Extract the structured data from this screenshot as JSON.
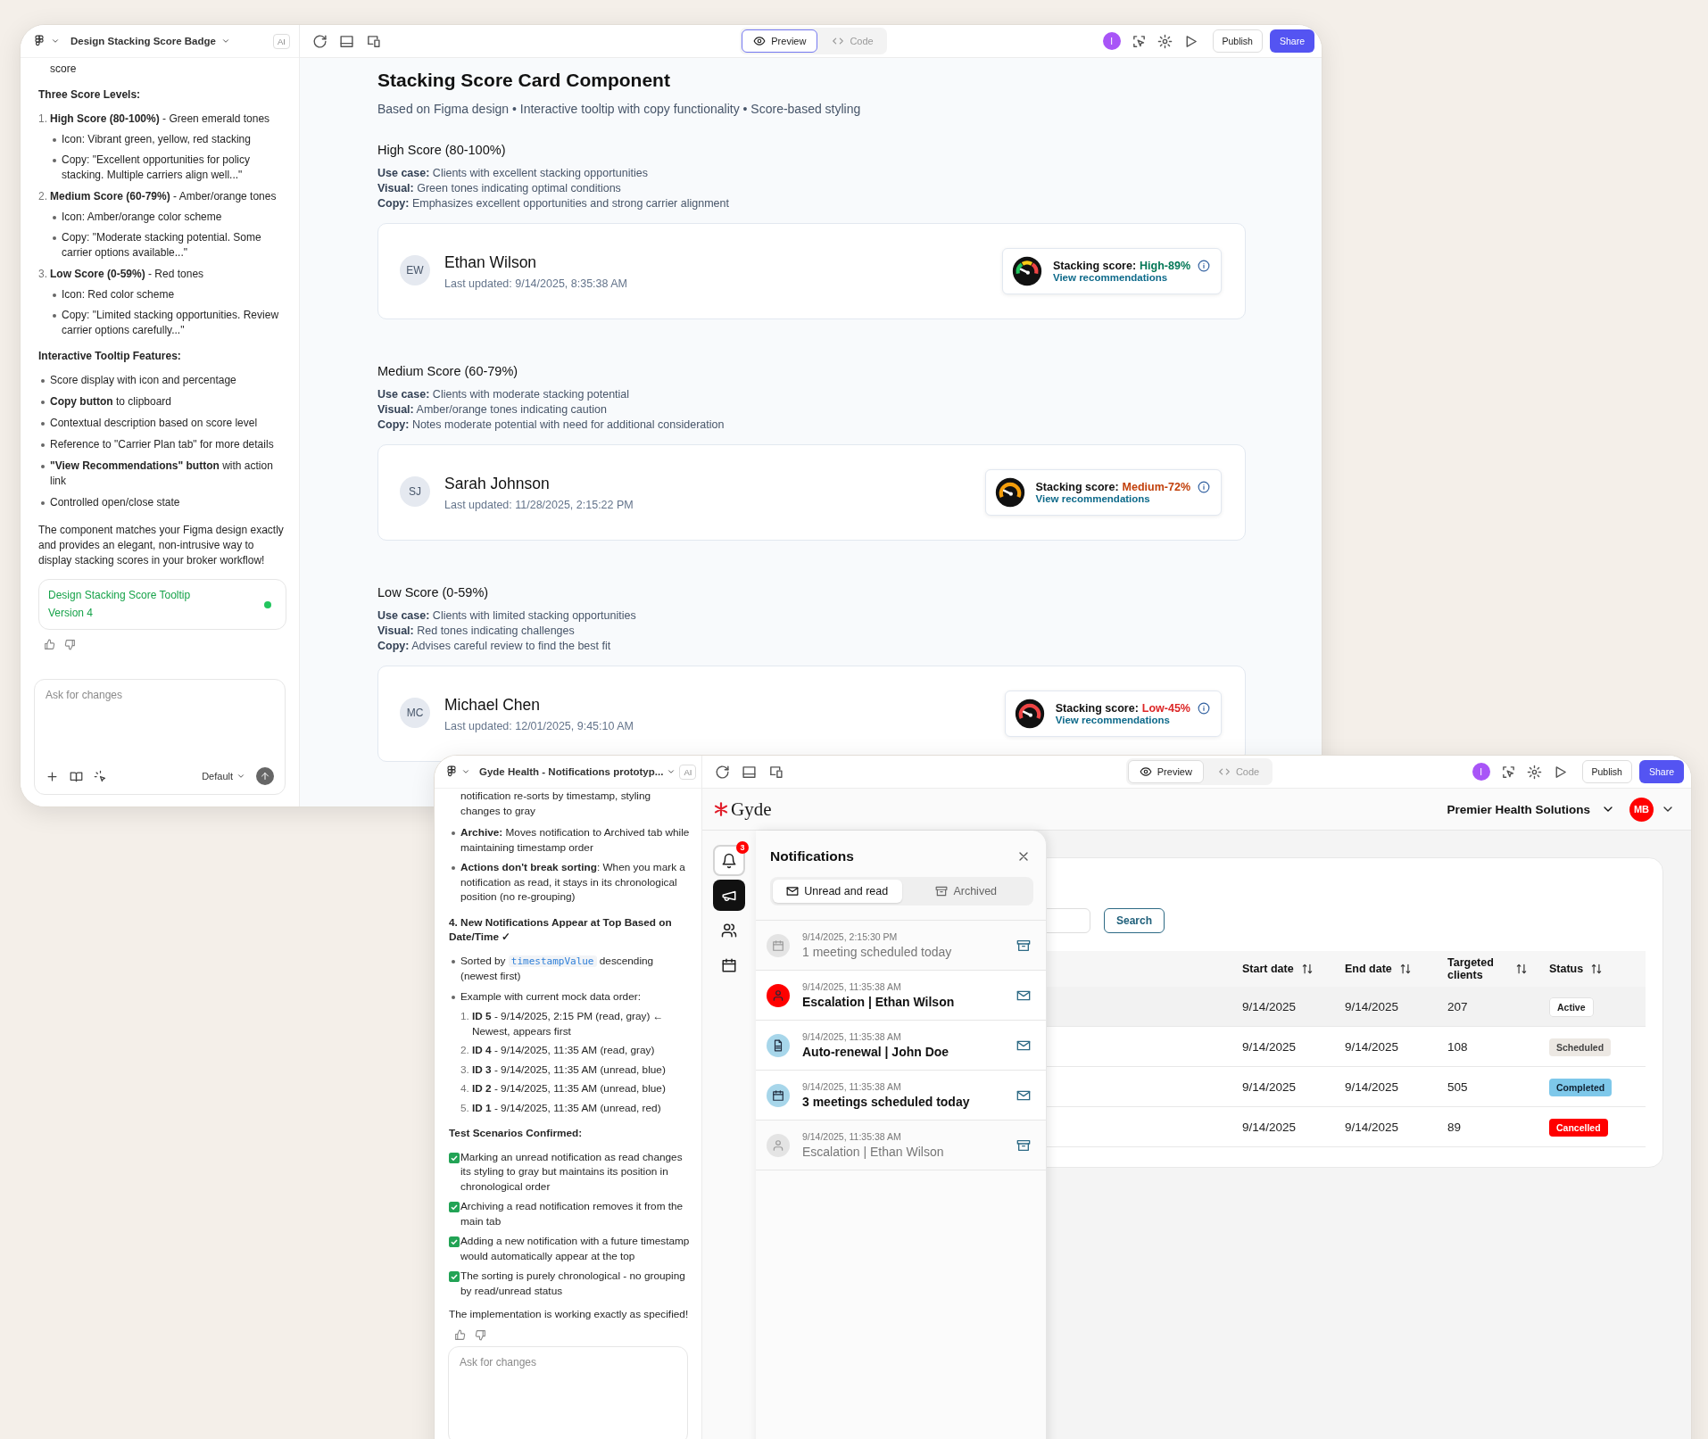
{
  "windows": [
    {
      "kind": "design",
      "title": "Design Stacking Score Badge",
      "ai_badge": "AI",
      "toolbar": {
        "view_tabs": [
          {
            "label": "Preview",
            "kind": "eye",
            "selected": true
          },
          {
            "label": "Code",
            "kind": "code",
            "selected": false
          }
        ],
        "avatar": "I",
        "publish": "Publish",
        "share": "Share"
      },
      "chat": {
        "blocks": [
          {
            "kind": "continuation",
            "text": "score"
          },
          {
            "kind": "heading",
            "text": "Three Score Levels:"
          },
          {
            "kind": "numbered",
            "number": "1.",
            "text": "**High Score (80-100%)** - Green emerald tones",
            "children": [
              {
                "kind": "bullet",
                "text": "Icon: Vibrant green, yellow, red stacking"
              },
              {
                "kind": "bullet",
                "text": "Copy: \"Excellent opportunities for policy stacking. Multiple carriers align well...\""
              }
            ]
          },
          {
            "kind": "numbered",
            "number": "2.",
            "text": "**Medium Score (60-79%)** - Amber/orange tones",
            "children": [
              {
                "kind": "bullet",
                "text": "Icon: Amber/orange color scheme"
              },
              {
                "kind": "bullet",
                "text": "Copy: \"Moderate stacking potential. Some carrier options available...\""
              }
            ]
          },
          {
            "kind": "numbered",
            "number": "3.",
            "text": "**Low Score (0-59%)** - Red tones",
            "children": [
              {
                "kind": "bullet",
                "text": "Icon: Red color scheme"
              },
              {
                "kind": "bullet",
                "text": "Copy: \"Limited stacking opportunities. Review carrier options carefully...\""
              }
            ]
          },
          {
            "kind": "heading",
            "text": "Interactive Tooltip Features:"
          },
          {
            "kind": "bullet",
            "text": "Score display with icon and percentage"
          },
          {
            "kind": "bullet",
            "text": "**Copy button** to clipboard"
          },
          {
            "kind": "bullet",
            "text": "Contextual description based on score level"
          },
          {
            "kind": "bullet",
            "text": "Reference to \"Carrier Plan tab\" for more details"
          },
          {
            "kind": "bullet",
            "text": "**\"View Recommendations\" button** with action link"
          },
          {
            "kind": "bullet",
            "text": "Controlled open/close state"
          },
          {
            "kind": "paragraph",
            "text": "The component matches your Figma design exactly and provides an elegant, non-intrusive way to display stacking scores in your broker workflow!"
          },
          {
            "kind": "version",
            "title": "Design Stacking Score Tooltip",
            "version": "Version 4",
            "live": true
          }
        ],
        "input": {
          "placeholder": "Ask for changes",
          "mode": "Default"
        }
      },
      "preview": {
        "title": "Stacking Score Card Component",
        "subtitle": "Based on Figma design • Interactive tooltip with copy functionality • Score-based styling",
        "sections": [
          {
            "heading": "High Score (80-100%)",
            "details": [
              "**Use case:** Clients with excellent stacking opportunities",
              "**Visual:** Green tones indicating optimal conditions",
              "**Copy:** Emphasizes excellent opportunities and strong carrier alignment"
            ],
            "client": {
              "initials": "EW",
              "name": "Ethan Wilson",
              "updated": "Last updated: 9/14/2025, 8:35:38 AM"
            },
            "score": {
              "label": "Stacking score:",
              "value": "High-89%",
              "kind": "high",
              "color": "#047857",
              "link": "View recommendations"
            }
          },
          {
            "heading": "Medium Score (60-79%)",
            "details": [
              "**Use case:** Clients with moderate stacking potential",
              "**Visual:** Amber/orange tones indicating caution",
              "**Copy:** Notes moderate potential with need for additional consideration"
            ],
            "client": {
              "initials": "SJ",
              "name": "Sarah Johnson",
              "updated": "Last updated: 11/28/2025, 2:15:22 PM"
            },
            "score": {
              "label": "Stacking score:",
              "value": "Medium-72%",
              "kind": "medium",
              "color": "#c2410c",
              "link": "View recommendations"
            }
          },
          {
            "heading": "Low Score (0-59%)",
            "details": [
              "**Use case:** Clients with limited stacking opportunities",
              "**Visual:** Red tones indicating challenges",
              "**Copy:** Advises careful review to find the best fit"
            ],
            "client": {
              "initials": "MC",
              "name": "Michael Chen",
              "updated": "Last updated: 12/01/2025, 9:45:10 AM"
            },
            "score": {
              "label": "Stacking score:",
              "value": "Low-45%",
              "kind": "low",
              "color": "#dc2626",
              "link": "View recommendations"
            }
          }
        ]
      }
    },
    {
      "kind": "app",
      "title": "Gyde Health - Notifications prototyp...",
      "ai_badge": "AI",
      "toolbar": {
        "view_tabs": [
          {
            "label": "Preview",
            "kind": "eye",
            "selected": true
          },
          {
            "label": "Code",
            "kind": "code",
            "selected": false
          }
        ],
        "avatar": "I",
        "publish": "Publish",
        "share": "Share"
      },
      "chat": {
        "blocks": [
          {
            "kind": "continuation",
            "text": "notification re-sorts by timestamp, styling changes to gray"
          },
          {
            "kind": "bullet",
            "text": "**Archive:** Moves notification to Archived tab while maintaining timestamp order"
          },
          {
            "kind": "bullet",
            "text": "**Actions don't break sorting**: When you mark a notification as read, it stays in its chronological position (no re-grouping)"
          },
          {
            "kind": "heading",
            "text": "4. New Notifications Appear at Top Based on Date/Time ✓"
          },
          {
            "kind": "code_bullet",
            "before": "Sorted by",
            "code": "timestampValue",
            "after": "descending (newest first)"
          },
          {
            "kind": "bullet",
            "text": "Example with current mock data order:",
            "children": [
              {
                "kind": "numbered",
                "number": "1.",
                "text": "**ID 5** - 9/14/2025, 2:15 PM (read, gray) ← Newest, appears first"
              },
              {
                "kind": "numbered",
                "number": "2.",
                "text": "**ID 4** - 9/14/2025, 11:35 AM (read, gray)"
              },
              {
                "kind": "numbered",
                "number": "3.",
                "text": "**ID 3** - 9/14/2025, 11:35 AM (unread, blue)"
              },
              {
                "kind": "numbered",
                "number": "4.",
                "text": "**ID 2** - 9/14/2025, 11:35 AM (unread, blue)"
              },
              {
                "kind": "numbered",
                "number": "5.",
                "text": "**ID 1** - 9/14/2025, 11:35 AM (unread, red)"
              }
            ]
          },
          {
            "kind": "heading",
            "text": "Test Scenarios Confirmed:"
          },
          {
            "kind": "check",
            "text": "Marking an unread notification as read changes its styling to gray but maintains its position in chronological order"
          },
          {
            "kind": "check",
            "text": "Archiving a read notification removes it from the main tab"
          },
          {
            "kind": "check",
            "text": "Adding a new notification with a future timestamp would automatically appear at the top"
          },
          {
            "kind": "check",
            "text": "The sorting is purely chronological - no grouping by read/unread status"
          },
          {
            "kind": "paragraph",
            "text": "The implementation is working exactly as specified!"
          }
        ],
        "input": {
          "placeholder": "Ask for changes"
        }
      },
      "app": {
        "brand": "Gyde",
        "org": "Premier Health Solutions",
        "user": "MB",
        "rail": [
          {
            "kind": "bell",
            "badge": "3",
            "focused": true,
            "selected": false
          },
          {
            "kind": "megaphone",
            "focused": false,
            "selected": true
          },
          {
            "kind": "users",
            "focused": false,
            "selected": false
          },
          {
            "kind": "calendar",
            "focused": false,
            "selected": false
          }
        ],
        "notifications": {
          "title": "Notifications",
          "tabs": [
            {
              "label": "Unread and read",
              "kind": "mail",
              "selected": true
            },
            {
              "label": "Archived",
              "kind": "archive",
              "selected": false
            }
          ],
          "items": [
            {
              "time": "9/14/2025, 2:15:30 PM",
              "title": "1 meeting scheduled today",
              "kind": "calendar",
              "read": true,
              "color": "#e4e4e4"
            },
            {
              "time": "9/14/2025, 11:35:38 AM",
              "title": "Escalation | Ethan Wilson",
              "kind": "user",
              "read": false,
              "color": "#ff0000"
            },
            {
              "time": "9/14/2025, 11:35:38 AM",
              "title": "Auto-renewal | John Doe",
              "kind": "file",
              "read": false,
              "color": "#a7d6ea"
            },
            {
              "time": "9/14/2025, 11:35:38 AM",
              "title": "3 meetings scheduled today",
              "kind": "calendar",
              "read": false,
              "color": "#a7d6ea"
            },
            {
              "time": "9/14/2025, 11:35:38 AM",
              "title": "Escalation | Ethan Wilson",
              "kind": "user",
              "read": true,
              "color": "#e4e4e4"
            }
          ]
        },
        "search_button": "Search",
        "table": {
          "columns": [
            "Start date",
            "End date",
            "Targeted clients",
            "Status"
          ],
          "rows": [
            {
              "cells": [
                "9/14/2025",
                "9/14/2025",
                "207"
              ],
              "status": {
                "label": "Active",
                "kind": "active"
              },
              "hovered": true
            },
            {
              "cells": [
                "9/14/2025",
                "9/14/2025",
                "108"
              ],
              "status": {
                "label": "Scheduled",
                "kind": "scheduled"
              },
              "hovered": false
            },
            {
              "cells": [
                "9/14/2025",
                "9/14/2025",
                "505"
              ],
              "status": {
                "label": "Completed",
                "kind": "completed"
              },
              "hovered": false
            },
            {
              "cells": [
                "9/14/2025",
                "9/14/2025",
                "89"
              ],
              "status": {
                "label": "Cancelled",
                "kind": "cancelled"
              },
              "hovered": false
            }
          ]
        }
      }
    }
  ]
}
